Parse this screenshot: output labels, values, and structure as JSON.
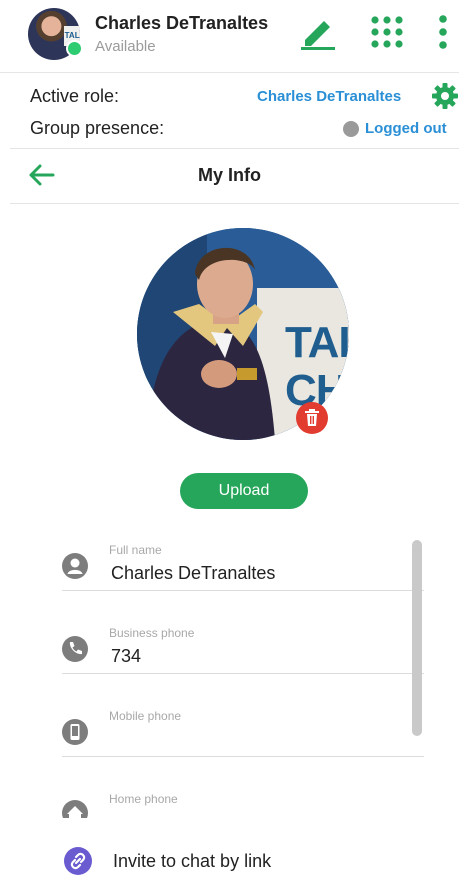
{
  "header": {
    "user_name": "Charles DeTranaltes",
    "status": "Available",
    "avatar_sign_text": "TALK",
    "icons": [
      "edit-icon",
      "dialpad-icon",
      "more-vert-icon"
    ]
  },
  "roles": {
    "active_role_label": "Active role:",
    "active_role_value": "Charles DeTranaltes",
    "group_presence_label": "Group presence:",
    "group_presence_value": "Logged out"
  },
  "page": {
    "title": "My Info",
    "back_icon": "arrow-left-icon"
  },
  "photo": {
    "sign_text_1": "TALK",
    "sign_text_2": "CH",
    "delete_icon": "trash-icon"
  },
  "upload_label": "Upload",
  "fields": [
    {
      "label": "Full name",
      "value": "Charles DeTranaltes",
      "icon": "person-icon"
    },
    {
      "label": "Business phone",
      "value": "734",
      "icon": "phone-icon"
    },
    {
      "label": "Mobile phone",
      "value": "",
      "icon": "mobile-icon"
    },
    {
      "label": "Home phone",
      "value": "",
      "icon": "home-icon"
    }
  ],
  "invite": {
    "label": "Invite to chat by link",
    "icon": "link-icon"
  },
  "colors": {
    "accent_green": "#26a65b",
    "link_blue": "#2b8fd6",
    "available_green": "#2ecc71",
    "delete_red": "#e23b30",
    "invite_purple": "#6a5bd0"
  }
}
